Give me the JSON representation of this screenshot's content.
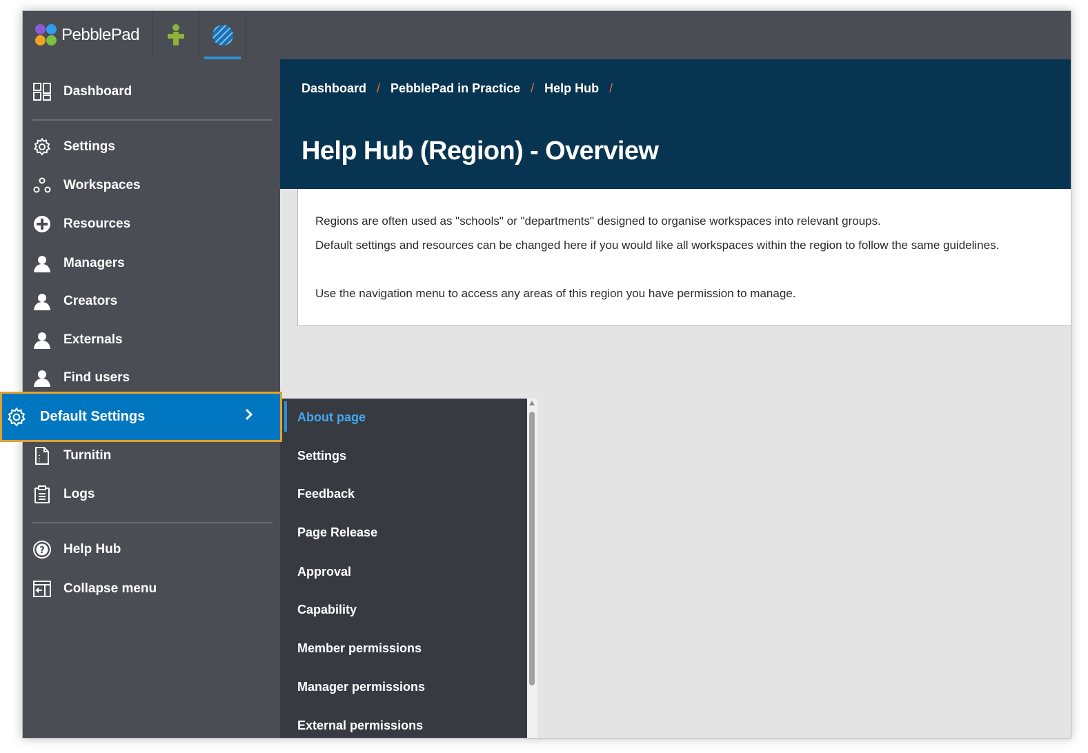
{
  "topbar": {
    "logo_text": "PebblePad",
    "apps": [
      {
        "name": "pebblepad-person-icon",
        "color": "#8db23a"
      },
      {
        "name": "atlas-globe-icon",
        "color": "#2f8fd6",
        "active": true
      }
    ]
  },
  "sidebar": {
    "items": [
      {
        "label": "Dashboard",
        "icon": "dashboard-icon"
      },
      {
        "label": "Settings",
        "icon": "gear-icon"
      },
      {
        "label": "Workspaces",
        "icon": "workspaces-icon"
      },
      {
        "label": "Resources",
        "icon": "resources-icon"
      },
      {
        "label": "Managers",
        "icon": "person-icon"
      },
      {
        "label": "Creators",
        "icon": "person-icon"
      },
      {
        "label": "Externals",
        "icon": "person-icon"
      },
      {
        "label": "Find users",
        "icon": "person-icon"
      },
      {
        "label": "Default Settings",
        "icon": "gear-icon",
        "highlighted": true
      },
      {
        "label": "Turnitin",
        "icon": "document-icon"
      },
      {
        "label": "Logs",
        "icon": "clipboard-icon"
      },
      {
        "label": "Help Hub",
        "icon": "help-icon"
      },
      {
        "label": "Collapse menu",
        "icon": "collapse-icon"
      }
    ]
  },
  "header": {
    "breadcrumb": [
      "Dashboard",
      "PebblePad in Practice",
      "Help Hub"
    ],
    "breadcrumb_separator": "/",
    "title": "Help Hub (Region) - Overview"
  },
  "content": {
    "line1": "Regions are often used as \"schools\" or \"departments\" designed to organise workspaces into relevant groups.",
    "line2": "Default settings and resources can be changed here if you would like all workspaces within the region to follow the same guidelines.",
    "line3": "Use the navigation menu to access any areas of this region you have permission to manage."
  },
  "submenu": {
    "items": [
      {
        "label": "About page",
        "active": true
      },
      {
        "label": "Settings"
      },
      {
        "label": "Feedback"
      },
      {
        "label": "Page Release"
      },
      {
        "label": "Approval"
      },
      {
        "label": "Capability"
      },
      {
        "label": "Member permissions"
      },
      {
        "label": "Manager permissions"
      },
      {
        "label": "External permissions"
      }
    ]
  },
  "colors": {
    "header_bg": "#073450",
    "sidebar_bg": "#4a4d53",
    "submenu_bg": "#373a41",
    "highlight_blue": "#0077c0",
    "highlight_border": "#e0a22e",
    "breadcrumb_separator": "#e8703a",
    "active_link": "#43a8f0"
  }
}
